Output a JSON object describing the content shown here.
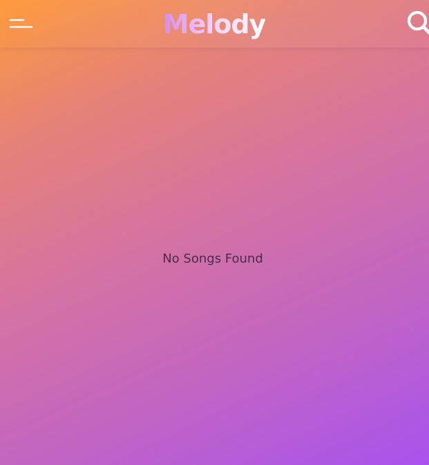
{
  "header": {
    "title": "Melody",
    "menu_icon": "menu-icon",
    "search_icon": "search-icon"
  },
  "main": {
    "empty_message": "No Songs Found"
  },
  "colors": {
    "gradient_start": "#fe9b3c",
    "gradient_end": "#a853ee",
    "title_gradient": [
      "#d58bf7",
      "#ffffff"
    ],
    "icon_color": "#ffffff",
    "message_color": "#4a2b4a"
  }
}
